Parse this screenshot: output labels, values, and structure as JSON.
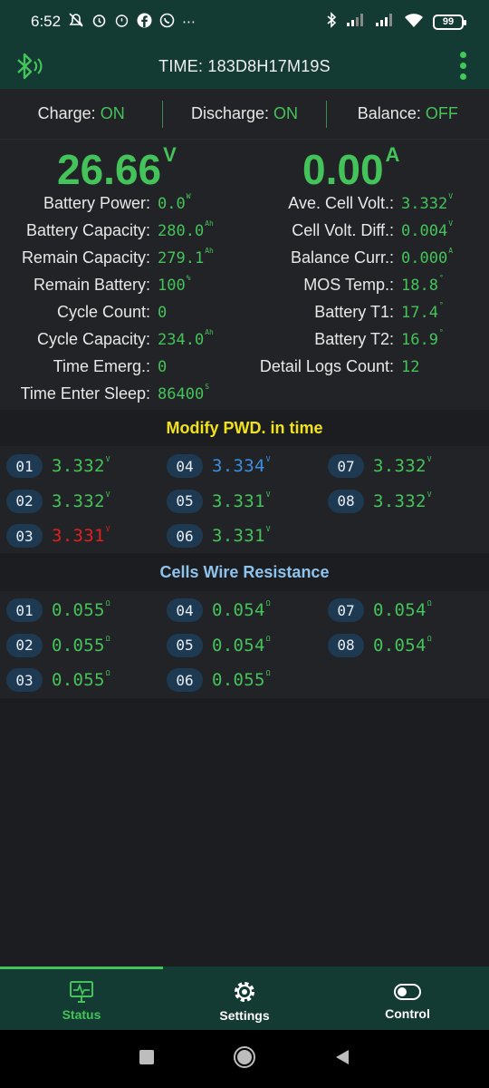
{
  "statusbar": {
    "time": "6:52",
    "battery_level": "99"
  },
  "appbar": {
    "title": "TIME: 183D8H17M19S"
  },
  "switches": {
    "charge_label": "Charge:",
    "charge_value": "ON",
    "discharge_label": "Discharge:",
    "discharge_value": "ON",
    "balance_label": "Balance:",
    "balance_value": "OFF"
  },
  "main": {
    "voltage": "26.66",
    "voltage_unit": "V",
    "current": "0.00",
    "current_unit": "A",
    "left": [
      {
        "label": "Battery Power:",
        "value": "0.0",
        "unit": "W"
      },
      {
        "label": "Battery Capacity:",
        "value": "280.0",
        "unit": "Ah"
      },
      {
        "label": "Remain Capacity:",
        "value": "279.1",
        "unit": "Ah"
      },
      {
        "label": "Remain Battery:",
        "value": "100",
        "unit": "%"
      },
      {
        "label": "Cycle Count:",
        "value": "0",
        "unit": ""
      },
      {
        "label": "Cycle Capacity:",
        "value": "234.0",
        "unit": "Ah"
      },
      {
        "label": "Time Emerg.:",
        "value": "0",
        "unit": ""
      },
      {
        "label": "Time Enter Sleep:",
        "value": "86400",
        "unit": "S"
      }
    ],
    "right": [
      {
        "label": "Ave. Cell Volt.:",
        "value": "3.332",
        "unit": "V"
      },
      {
        "label": "Cell Volt. Diff.:",
        "value": "0.004",
        "unit": "V"
      },
      {
        "label": "Balance Curr.:",
        "value": "0.000",
        "unit": "A"
      },
      {
        "label": "MOS Temp.:",
        "value": "18.8",
        "unit": "°"
      },
      {
        "label": "Battery T1:",
        "value": "17.4",
        "unit": "°"
      },
      {
        "label": "Battery T2:",
        "value": "16.9",
        "unit": "°"
      },
      {
        "label": "Detail Logs Count:",
        "value": "12",
        "unit": ""
      }
    ]
  },
  "voltages": {
    "title": "Modify PWD. in time",
    "title_color": "#f2e21c",
    "cells": [
      {
        "id": "01",
        "value": "3.332",
        "unit": "V"
      },
      {
        "id": "02",
        "value": "3.332",
        "unit": "V"
      },
      {
        "id": "03",
        "value": "3.331",
        "unit": "V"
      },
      {
        "id": "04",
        "value": "3.334",
        "unit": "V"
      },
      {
        "id": "05",
        "value": "3.331",
        "unit": "V"
      },
      {
        "id": "06",
        "value": "3.331",
        "unit": "V"
      },
      {
        "id": "07",
        "value": "3.332",
        "unit": "V"
      },
      {
        "id": "08",
        "value": "3.332",
        "unit": "V"
      }
    ]
  },
  "resistance": {
    "title": "Cells Wire Resistance",
    "title_color": "#8ec3ee",
    "cells": [
      {
        "id": "01",
        "value": "0.055",
        "unit": "Ω"
      },
      {
        "id": "02",
        "value": "0.055",
        "unit": "Ω"
      },
      {
        "id": "03",
        "value": "0.055",
        "unit": "Ω"
      },
      {
        "id": "04",
        "value": "0.054",
        "unit": "Ω"
      },
      {
        "id": "05",
        "value": "0.054",
        "unit": "Ω"
      },
      {
        "id": "06",
        "value": "0.055",
        "unit": "Ω"
      },
      {
        "id": "07",
        "value": "0.054",
        "unit": "Ω"
      },
      {
        "id": "08",
        "value": "0.054",
        "unit": "Ω"
      }
    ]
  },
  "nav": {
    "status": "Status",
    "settings": "Settings",
    "control": "Control"
  },
  "colors": {
    "accent_green": "#44c35a",
    "max_cell_blue": "#3a8fe0",
    "min_cell_red": "#e02020",
    "bar_bg": "#133a33"
  }
}
